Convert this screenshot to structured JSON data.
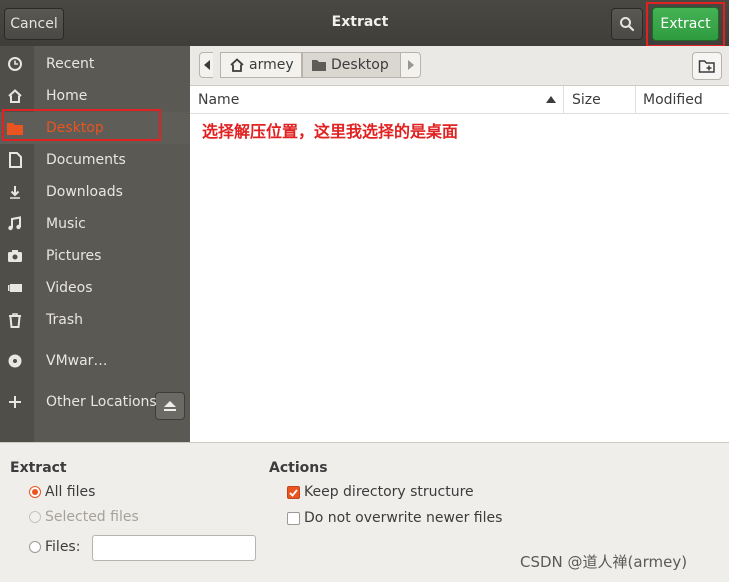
{
  "header": {
    "cancel_label": "Cancel",
    "title": "Extract",
    "extract_label": "Extract",
    "search_icon": "search-icon"
  },
  "sidebar": {
    "items": [
      {
        "label": "Recent",
        "icon": "clock-icon"
      },
      {
        "label": "Home",
        "icon": "home-icon"
      },
      {
        "label": "Desktop",
        "icon": "folder-icon"
      },
      {
        "label": "Documents",
        "icon": "document-icon"
      },
      {
        "label": "Downloads",
        "icon": "download-icon"
      },
      {
        "label": "Music",
        "icon": "music-icon"
      },
      {
        "label": "Pictures",
        "icon": "camera-icon"
      },
      {
        "label": "Videos",
        "icon": "video-icon"
      },
      {
        "label": "Trash",
        "icon": "trash-icon"
      },
      {
        "label": "VMwar…",
        "icon": "disc-icon"
      },
      {
        "label": "Other Locations",
        "icon": "plus-icon"
      }
    ],
    "active_index": 2
  },
  "pathbar": {
    "crumbs": [
      "armey",
      "Desktop"
    ]
  },
  "filelist": {
    "columns": {
      "name": "Name",
      "size": "Size",
      "modified": "Modified"
    },
    "annotation": "选择解压位置，这里我选择的是桌面"
  },
  "options": {
    "extract_heading": "Extract",
    "all_files": "All files",
    "selected_files": "Selected files",
    "files_label": "Files:",
    "files_value": "",
    "actions_heading": "Actions",
    "keep_structure": "Keep directory structure",
    "no_overwrite": "Do not overwrite newer files"
  },
  "watermark": "CSDN @道人禅(armey)",
  "colors": {
    "accent": "#e95420",
    "extract_green": "#38a848",
    "highlight_red": "#e02222"
  }
}
